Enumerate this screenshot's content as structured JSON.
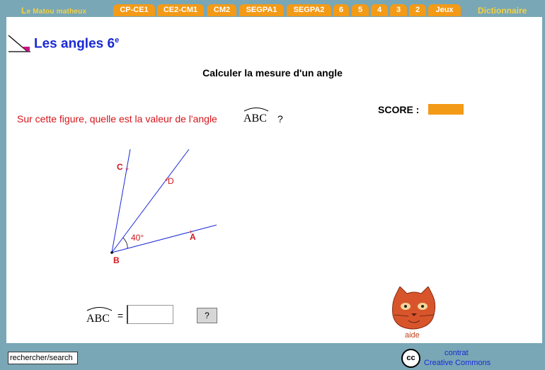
{
  "header": {
    "site_title_first": "L",
    "site_title_rest": "e Matou matheux",
    "tabs": [
      "CP-CE1",
      "CE2-CM1",
      "CM2",
      "SEGPA1",
      "SEGPA2",
      "6",
      "5",
      "4",
      "3",
      "2",
      "Jeux"
    ],
    "dictionary": "Dictionnaire"
  },
  "lesson": {
    "title": "Les angles 6",
    "title_sup": "e",
    "subtitle": "Calculer la mesure d'un angle",
    "question": "Sur cette figure, quelle est la valeur de l'angle",
    "angle_name": "ABC",
    "question_mark": "?"
  },
  "score": {
    "label": "SCORE :",
    "color": "#f39a16"
  },
  "figure": {
    "points": [
      "C",
      "D",
      "B",
      "A"
    ],
    "known_angle": "40°"
  },
  "answer": {
    "angle_name": "ABC",
    "equals": "=",
    "value": "",
    "help_button": "?"
  },
  "help": {
    "label": "aide",
    "icon": "cat-icon"
  },
  "footer": {
    "search_label": "rechercher/search",
    "cc_icon_text": "cc",
    "contract": "contrat",
    "cc": "Creative Commons"
  }
}
